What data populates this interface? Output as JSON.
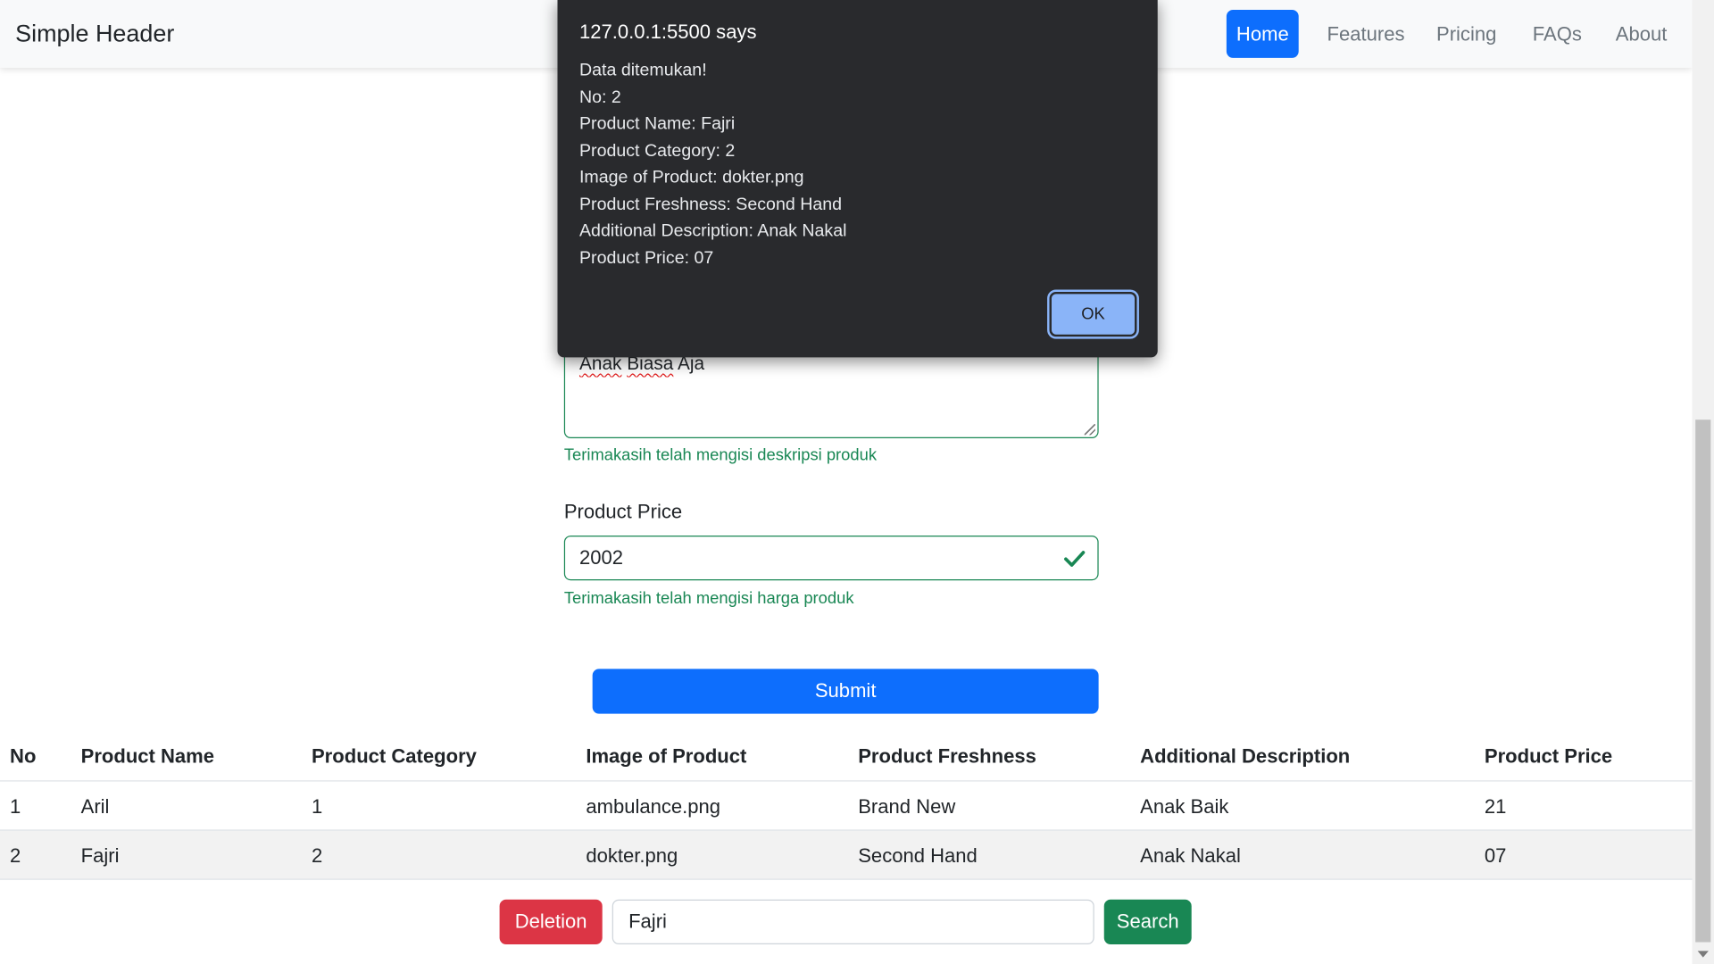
{
  "header": {
    "brand": "Simple Header",
    "nav": [
      "Home",
      "Features",
      "Pricing",
      "FAQs",
      "About"
    ],
    "active": "Home"
  },
  "form": {
    "description_value_word1": "Anak",
    "description_value_word2": "Biasa",
    "description_value_word3": "Aja",
    "description_feedback": "Terimakasih telah mengisi deskripsi produk",
    "price_label": "Product Price",
    "price_value": "2002",
    "price_feedback": "Terimakasih telah mengisi harga produk",
    "submit_label": "Submit"
  },
  "table": {
    "headers": [
      "No",
      "Product Name",
      "Product Category",
      "Image of Product",
      "Product Freshness",
      "Additional Description",
      "Product Price"
    ],
    "rows": [
      [
        "1",
        "Aril",
        "1",
        "ambulance.png",
        "Brand New",
        "Anak Baik",
        "21"
      ],
      [
        "2",
        "Fajri",
        "2",
        "dokter.png",
        "Second Hand",
        "Anak Nakal",
        "07"
      ]
    ]
  },
  "controls": {
    "delete_label": "Deletion",
    "search_value": "Fajri",
    "search_label": "Search"
  },
  "dialog": {
    "title": "127.0.0.1:5500 says",
    "lines": [
      "Data ditemukan!",
      "No: 2",
      "Product Name: Fajri",
      "Product Category: 2",
      "Image of Product: dokter.png",
      "Product Freshness: Second Hand",
      "Additional Description: Anak Nakal",
      "Product Price: 07"
    ],
    "ok_label": "OK"
  },
  "colors": {
    "primary": "#0d6efd",
    "success": "#198754",
    "danger": "#dc3545",
    "dialog_bg": "#292a2d",
    "dialog_button": "#8ab4f8"
  }
}
